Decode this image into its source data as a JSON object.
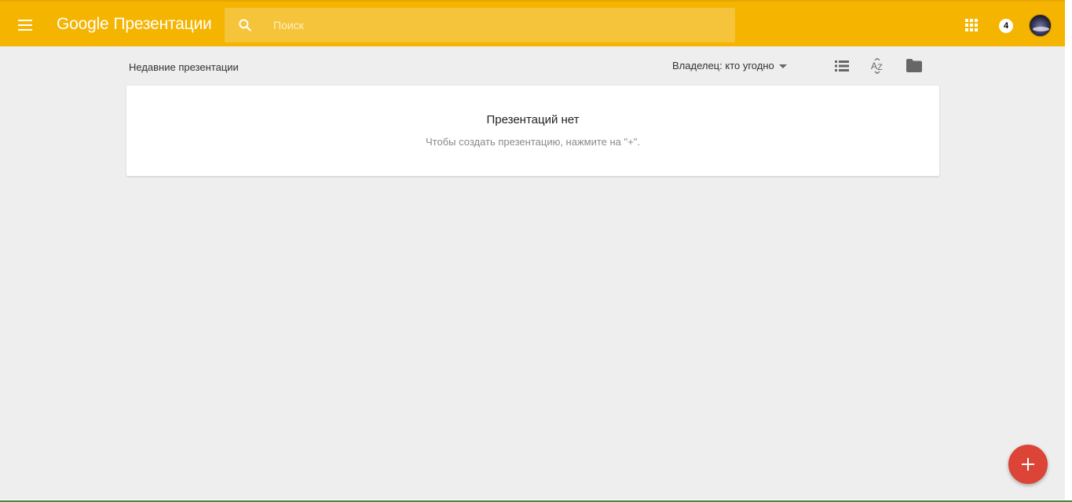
{
  "header": {
    "brand": "Google",
    "app_name": "Презентации",
    "bg_color": "#f4b400",
    "menu_icon": "hamburger-menu-icon",
    "search": {
      "placeholder": "Поиск",
      "icon": "search-icon"
    },
    "apps_icon": "apps-grid-icon",
    "notifications_count": "4",
    "avatar_icon": "user-avatar"
  },
  "toolbar": {
    "title": "Недавние презентации",
    "owner_filter": "Владелец: кто угодно",
    "icons": [
      "list-view-icon",
      "sort-az-icon",
      "folder-icon"
    ]
  },
  "empty_state": {
    "title": "Презентаций нет",
    "hint": "Чтобы создать презентацию, нажмите на \"+\"."
  },
  "fab": {
    "icon": "plus-icon",
    "color": "#db4437"
  }
}
